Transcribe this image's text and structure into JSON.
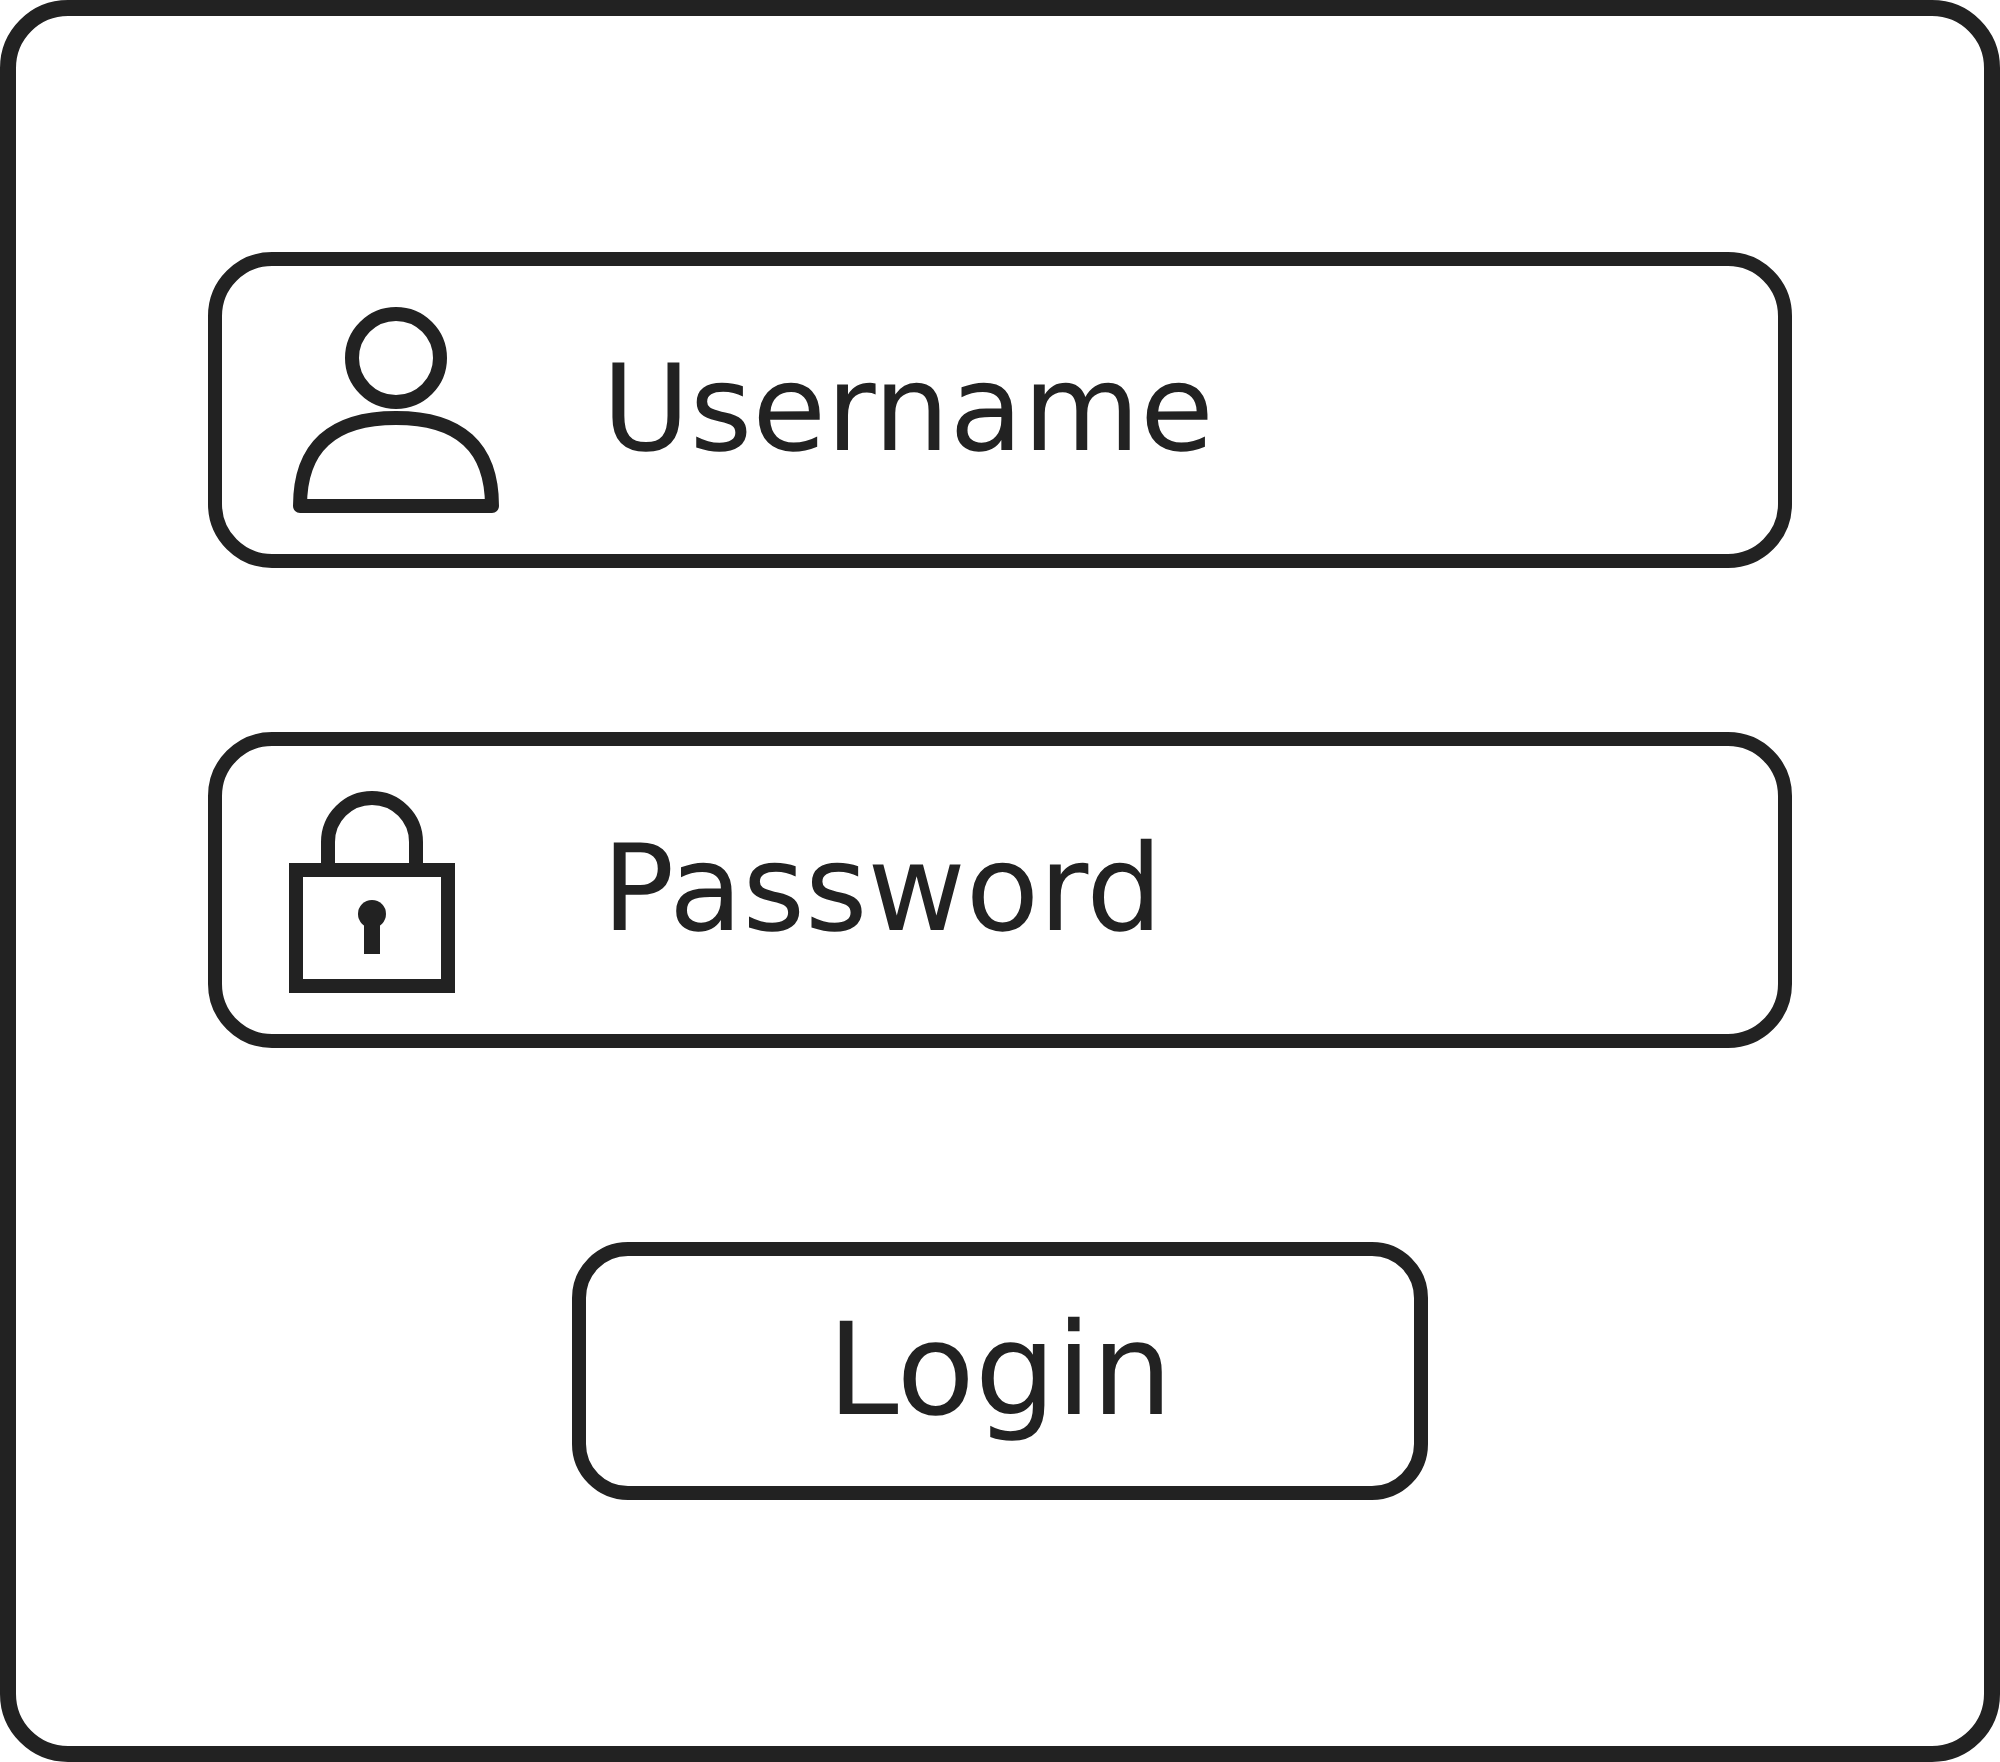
{
  "fields": [
    {
      "kind": "user",
      "placeholder": "Username"
    },
    {
      "kind": "lock",
      "placeholder": "Password"
    }
  ],
  "button": {
    "label": "Login"
  }
}
